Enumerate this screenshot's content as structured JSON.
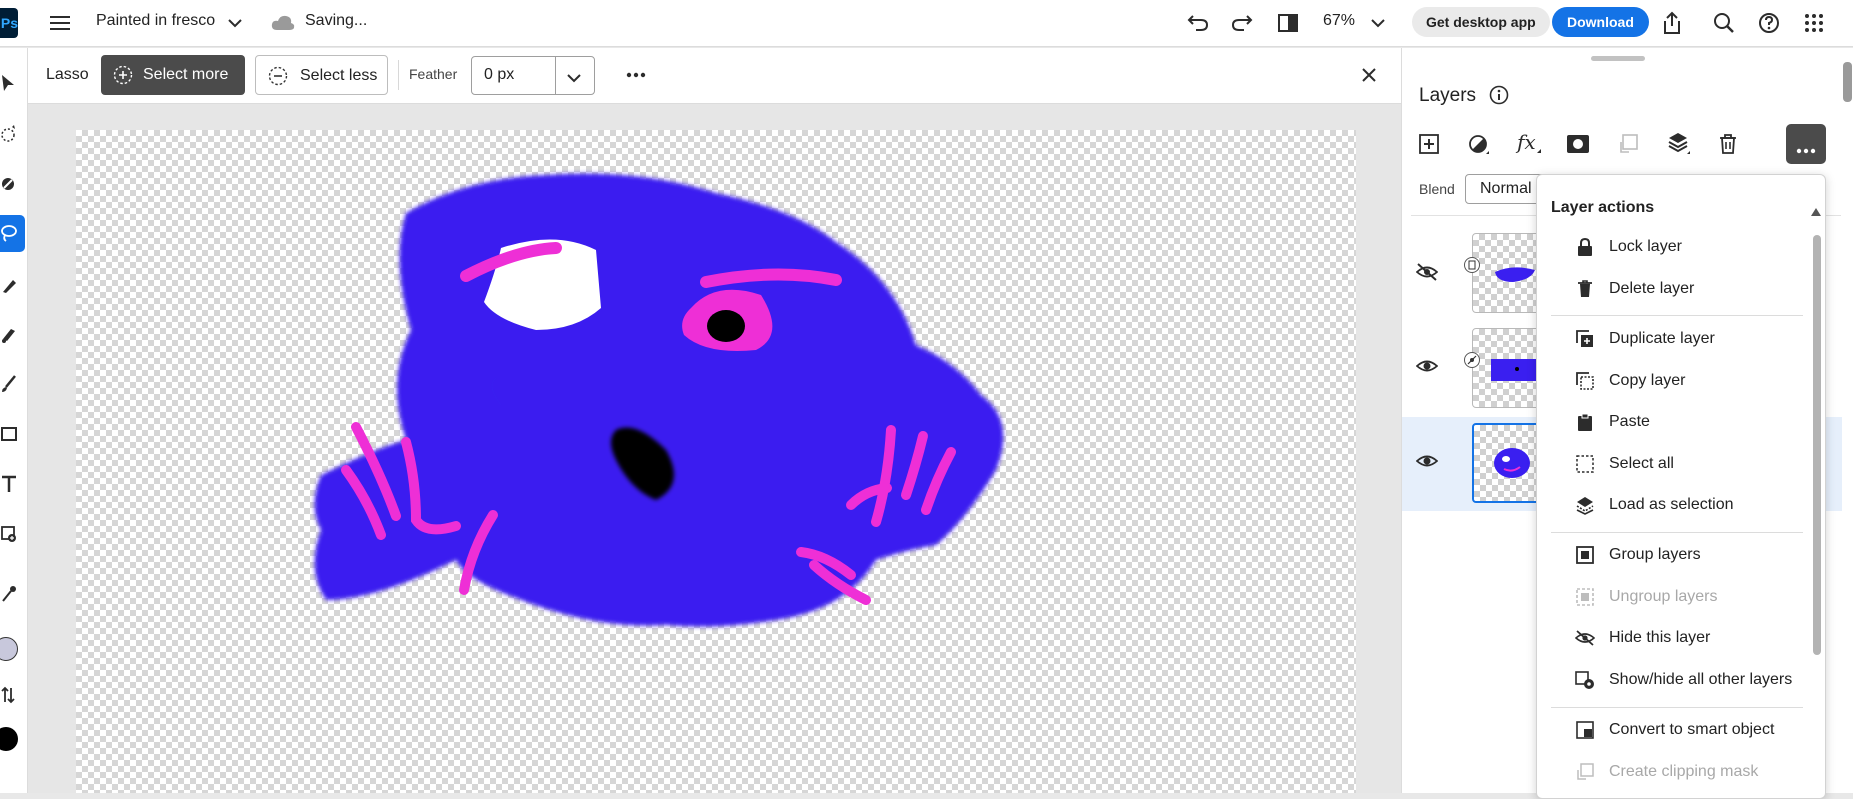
{
  "app": {
    "logo_text": "Ps",
    "document_title": "Painted in fresco",
    "save_status": "Saving...",
    "zoom": "67%",
    "get_desktop_label": "Get desktop app",
    "download_label": "Download"
  },
  "options_bar": {
    "tool_name": "Lasso",
    "select_more_label": "Select more",
    "select_less_label": "Select less",
    "feather_label": "Feather",
    "feather_value": "0 px"
  },
  "layers_panel": {
    "title": "Layers",
    "blend_label": "Blend",
    "blend_value": "Normal",
    "layers": [
      {
        "visible": false,
        "selected": false
      },
      {
        "visible": true,
        "selected": false
      },
      {
        "visible": true,
        "selected": true
      }
    ]
  },
  "layer_actions_menu": {
    "title": "Layer actions",
    "items": [
      {
        "label": "Lock layer",
        "icon": "lock-icon",
        "enabled": true
      },
      {
        "label": "Delete layer",
        "icon": "trash-icon",
        "enabled": true
      },
      {
        "label": "Duplicate layer",
        "icon": "duplicate-icon",
        "enabled": true
      },
      {
        "label": "Copy layer",
        "icon": "copy-icon",
        "enabled": true
      },
      {
        "label": "Paste",
        "icon": "clipboard-icon",
        "enabled": true
      },
      {
        "label": "Select all",
        "icon": "select-all-icon",
        "enabled": true
      },
      {
        "label": "Load as selection",
        "icon": "load-selection-icon",
        "enabled": true
      },
      {
        "label": "Group layers",
        "icon": "group-icon",
        "enabled": true
      },
      {
        "label": "Ungroup layers",
        "icon": "ungroup-icon",
        "enabled": false
      },
      {
        "label": "Hide this layer",
        "icon": "eye-off-icon",
        "enabled": true
      },
      {
        "label": "Show/hide all other layers",
        "icon": "show-hide-others-icon",
        "enabled": true
      },
      {
        "label": "Convert to smart object",
        "icon": "smart-object-icon",
        "enabled": true
      },
      {
        "label": "Create clipping mask",
        "icon": "clipping-mask-icon",
        "enabled": false
      }
    ]
  },
  "colors": {
    "accent": "#1473e6",
    "paint_blue": "#3a1ff0",
    "paint_pink": "#ee2fd6",
    "foreground_swatch": "#000000",
    "background_swatch": "#c8c8dc"
  }
}
